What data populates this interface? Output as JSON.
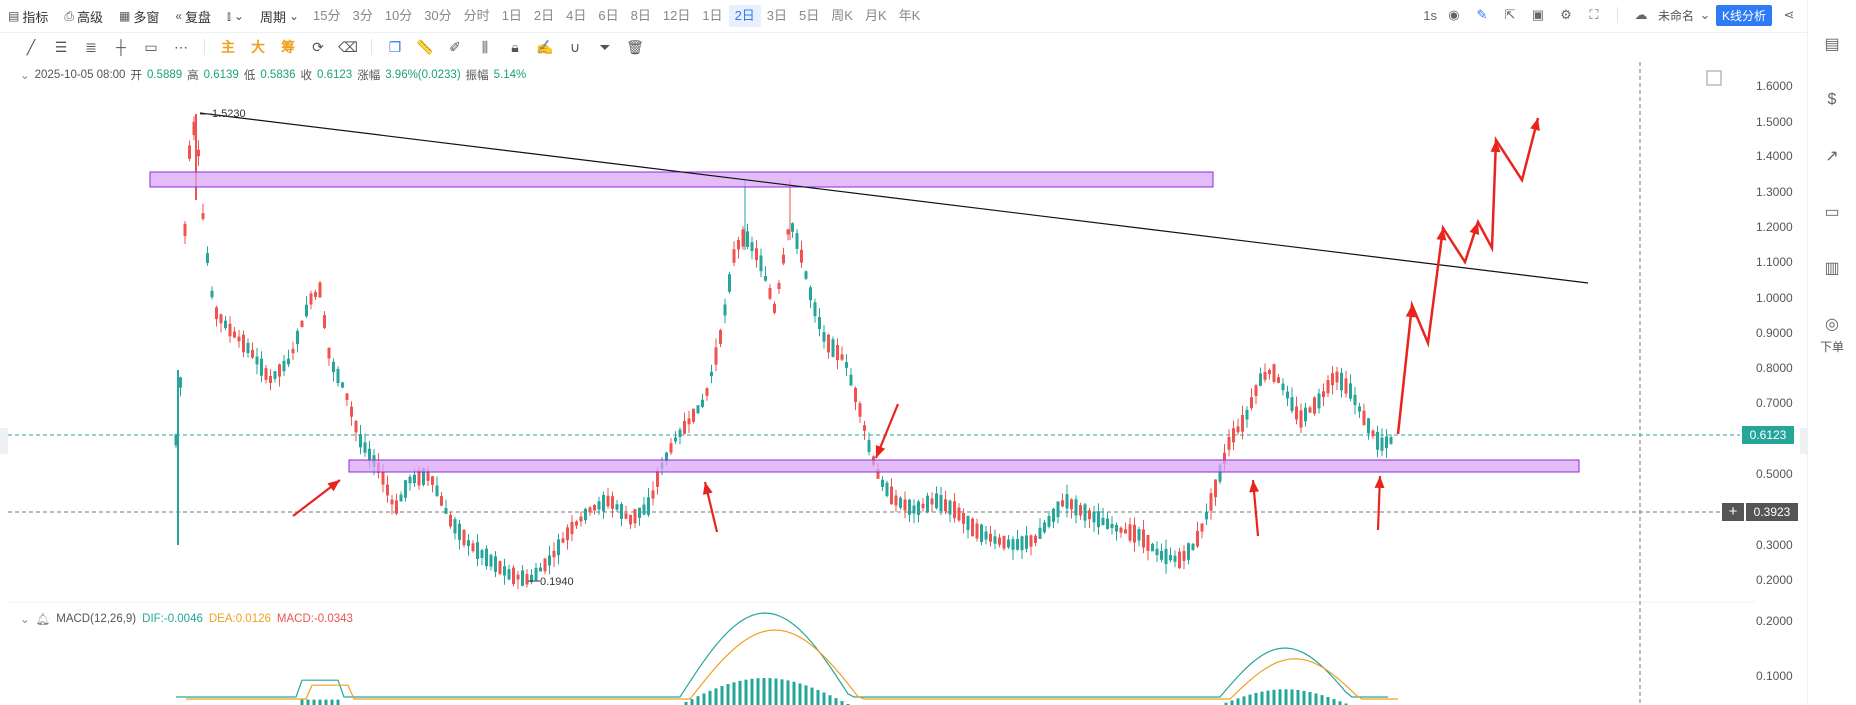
{
  "toolbar": {
    "buttons": [
      {
        "icon": "chart-icon",
        "label": "指标"
      },
      {
        "icon": "print-icon",
        "label": "高级"
      },
      {
        "icon": "grid-icon",
        "label": "多窗"
      },
      {
        "icon": "rewind-icon",
        "label": "复盘"
      }
    ],
    "candle_type_icon": "candle-type-icon",
    "period_label": "周期",
    "periods": [
      "15分",
      "3分",
      "10分",
      "30分",
      "分时",
      "1日",
      "2日",
      "4日",
      "6日",
      "8日",
      "12日",
      "1日",
      "2日",
      "3日",
      "5日",
      "周K",
      "月K",
      "年K"
    ],
    "active_period": "2日",
    "right": {
      "interval": "1s",
      "layout_name": "未命名",
      "analysis_button": "K线分析"
    }
  },
  "drawing_tools": {
    "text_tools": [
      "主",
      "大",
      "筹"
    ]
  },
  "info": {
    "date": "2025-10-05 08:00",
    "open_label": "开",
    "open": "0.5889",
    "high_label": "高",
    "high": "0.6139",
    "low_label": "低",
    "low": "0.5836",
    "close_label": "收",
    "close": "0.6123",
    "change_label": "涨幅",
    "change": "3.96%(0.0233)",
    "amplitude_label": "振幅",
    "amplitude": "5.14%"
  },
  "macd": {
    "label": "MACD(12,26,9)",
    "dif": "DIF:-0.0046",
    "dea": "DEA:0.0126",
    "macd": "MACD:-0.0343"
  },
  "price_axis": {
    "labels": [
      "1.6000",
      "1.5000",
      "1.4000",
      "1.3000",
      "1.2000",
      "1.1000",
      "1.0000",
      "0.9000",
      "0.8000",
      "0.7000",
      "0.5000",
      "0.3000",
      "0.2000"
    ],
    "current_price": "0.6123",
    "crosshair_price": "0.3923",
    "macd_labels": [
      "0.2000",
      "0.1000"
    ]
  },
  "annotations": {
    "high_mark": "1.5230",
    "low_mark": "0.1940"
  },
  "sidebar": {
    "order_label": "下单"
  },
  "colors": {
    "up": "#26a69a",
    "down": "#ef5350",
    "zone_fill": "#d9a6f5",
    "zone_stroke": "#8a2be2",
    "arrow": "#e8241c",
    "accent": "#2f7bf5",
    "dif": "#26a69a",
    "dea": "#f0a020"
  }
}
